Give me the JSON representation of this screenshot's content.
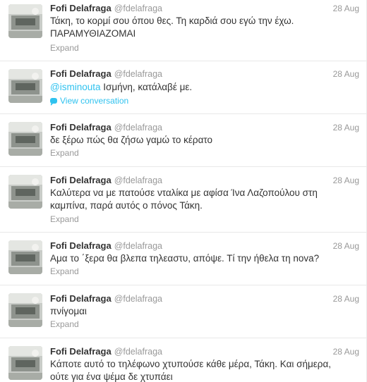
{
  "author": {
    "fullname": "Fofi Delafraga",
    "username": "@fdelafraga"
  },
  "expand_label": "Expand",
  "view_conversation_label": "View conversation",
  "tweets": [
    {
      "time": "28 Aug",
      "line1": "Τάκη, το κορμί σου όπου θες. Τη καρδιά σου εγώ την έχω.",
      "line2": "ΠΑΡΑΜΥΘΙΑΖΟΜΑΙ"
    },
    {
      "time": "28 Aug",
      "mention": "@isminouta",
      "line1": " Ισμήνη, κατάλαβέ με."
    },
    {
      "time": "28 Aug",
      "line1": "δε ξέρω πώς θα ζήσω γαμώ το κέρατο"
    },
    {
      "time": "28 Aug",
      "line1": "Καλύτερα να με πατούσε νταλίκα με αφίσα Ίνα Λαζοπούλου στη",
      "line2": "καμπίνα, παρά αυτός ο πόνος Τάκη."
    },
    {
      "time": "28 Aug",
      "line1": "Αμα το ΄ξερα θα βλεπα τηλεαστυ, απόψε. Τί την ήθελα τη nova?"
    },
    {
      "time": "28 Aug",
      "line1": "πνίγομαι"
    },
    {
      "time": "28 Aug",
      "line1": "Κάποτε αυτό το τηλέφωνο χτυπούσε κάθε μέρα, Τάκη. Και σήμερα,",
      "line2": "ούτε για ένα ψέμα δε χτυπάει"
    }
  ]
}
